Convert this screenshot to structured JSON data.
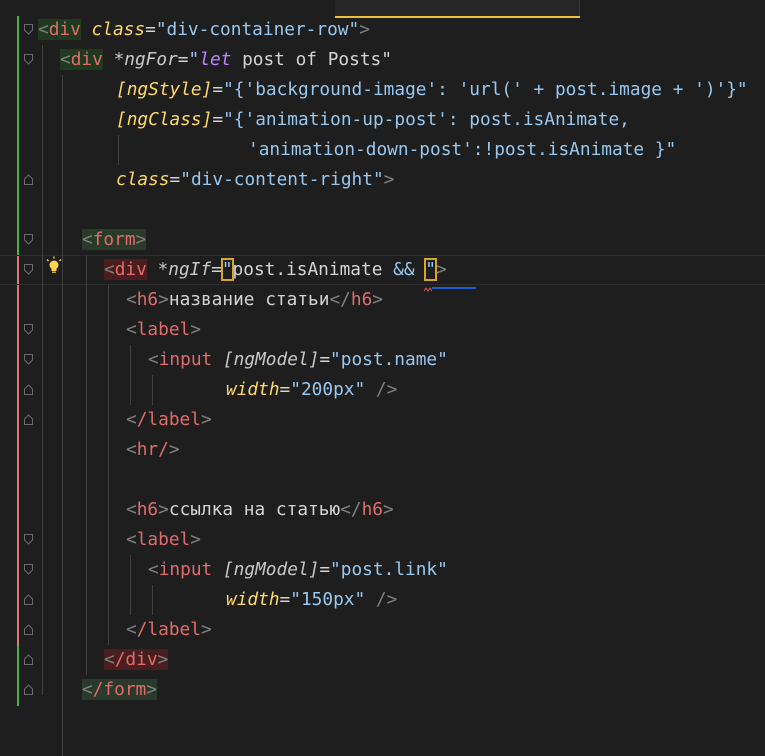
{
  "colors": {
    "background": "#1e1e1e",
    "tag": "#e06c6c",
    "attribute": "#ffd866",
    "string": "#98c8f0",
    "keyword": "#bb86fc",
    "bracket": "#808080",
    "text": "#d4d4d4",
    "gutter_green": "#4caf50",
    "gutter_red": "#e57373",
    "active_tab": "#e8c33a",
    "squiggle": "#1f5cd6"
  },
  "icons": {
    "gutter_fold": "fold-chevron-icon",
    "hint": "lightbulb-icon"
  },
  "code": {
    "l1": {
      "tag": "div",
      "attr": "class",
      "eq": "=",
      "val": "\"div-container-row\"",
      "close": ">"
    },
    "l2": {
      "tag": "div",
      "directive": "*ngFor",
      "eq": "=",
      "q": "\"",
      "kw": "let",
      "rest": " post of Posts\""
    },
    "l3": {
      "attr": "[ngStyle]",
      "eq": "=",
      "val": "\"{'background-image': 'url(' + post.image + ')'}\""
    },
    "l4": {
      "attr": "[ngClass]",
      "eq": "=",
      "val": "\"{'animation-up-post': post.isAnimate,"
    },
    "l5": {
      "val": "'animation-down-post':!post.isAnimate }\""
    },
    "l6": {
      "attr": "class",
      "eq": "=",
      "val": "\"div-content-right\"",
      "close": ">"
    },
    "l8": {
      "tag": "form",
      "close": ">"
    },
    "l9": {
      "tag": "div",
      "directive": "*ngIf",
      "eq": "=",
      "q1": "\"",
      "text": "post.isAnimate ",
      "op": "&&",
      "gap": " ",
      "q2": "\"",
      "close": ">"
    },
    "l10": {
      "tag": "h6",
      "text": "название статьи",
      "end": "h6"
    },
    "l11": {
      "tag": "label"
    },
    "l12": {
      "tag": "input",
      "attr": "[ngModel]",
      "eq": "=",
      "val": "\"post.name\""
    },
    "l13": {
      "attr": "width",
      "eq": "=",
      "val": "\"200px\"",
      "close": "/>"
    },
    "l14": {
      "tag": "/label"
    },
    "l15": {
      "tag": "hr/"
    },
    "l17": {
      "tag": "h6",
      "text": "ссылка на статью",
      "end": "h6"
    },
    "l18": {
      "tag": "label"
    },
    "l19": {
      "tag": "input",
      "attr": "[ngModel]",
      "eq": "=",
      "val": "\"post.link\""
    },
    "l20": {
      "attr": "width",
      "eq": "=",
      "val": "\"150px\"",
      "close": "/>"
    },
    "l21": {
      "tag": "/label"
    },
    "l22": {
      "tag": "/div"
    },
    "l23": {
      "tag": "/form"
    }
  }
}
